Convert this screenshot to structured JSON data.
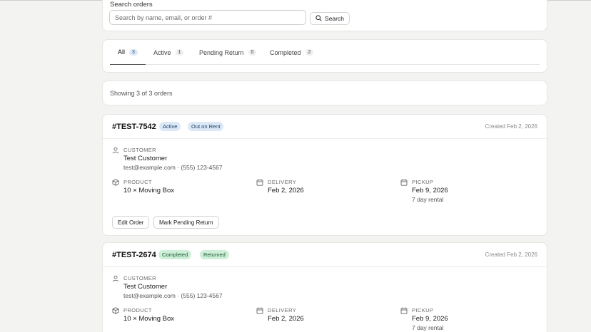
{
  "search": {
    "label": "Search orders",
    "placeholder": "Search by name, email, or order #",
    "value": "",
    "button_label": "Search"
  },
  "tabs": [
    {
      "label": "All",
      "count": "3",
      "active": true
    },
    {
      "label": "Active",
      "count": "1",
      "active": false
    },
    {
      "label": "Pending Return",
      "count": "0",
      "active": false
    },
    {
      "label": "Completed",
      "count": "2",
      "active": false
    }
  ],
  "summary": "Showing 3 of 3 orders",
  "labels": {
    "customer": "CUSTOMER",
    "product": "PRODUCT",
    "delivery": "DELIVERY",
    "pickup": "PICKUP"
  },
  "orders": [
    {
      "id": "#TEST-7542",
      "status": "Active",
      "substatus": "Out on Rent",
      "created": "Created Feb 2, 2026",
      "customer_name": "Test Customer",
      "customer_contact": "test@example.com · (555) 123-4567",
      "product": "10 × Moving Box",
      "delivery": "Feb 2, 2026",
      "pickup": "Feb 9, 2026",
      "rental": "7 day rental",
      "actions": [
        "Edit Order",
        "Mark Pending Return"
      ]
    },
    {
      "id": "#TEST-2674",
      "status": "Completed",
      "substatus": "Returned",
      "created": "Created Feb 2, 2026",
      "customer_name": "Test Customer",
      "customer_contact": "test@example.com · (555) 123-4567",
      "product": "10 × Moving Box",
      "delivery": "Feb 2, 2026",
      "pickup": "Feb 9, 2026",
      "rental": "7 day rental"
    }
  ],
  "colors": {
    "active_badge": "#dbe8f6",
    "completed_badge": "#cdeed7"
  }
}
